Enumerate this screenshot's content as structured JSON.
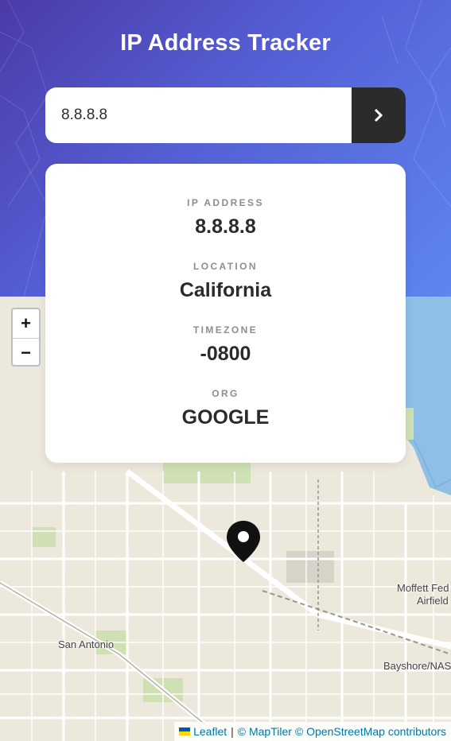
{
  "header": {
    "title": "IP Address Tracker"
  },
  "search": {
    "value": "8.8.8.8",
    "button_icon": "chevron-right-icon"
  },
  "info": {
    "ip_label": "IP ADDRESS",
    "ip_value": "8.8.8.8",
    "location_label": "LOCATION",
    "location_value": "California",
    "timezone_label": "TIMEZONE",
    "timezone_value": "-0800",
    "org_label": "ORG",
    "org_value": "GOOGLE"
  },
  "map": {
    "zoom_in": "+",
    "zoom_out": "−",
    "labels": {
      "san_antonio": "San Antonio",
      "moffett_1": "Moffett Fed",
      "moffett_2": "Airfield",
      "bayshore": "Bayshore/NAS"
    },
    "attribution": {
      "leaflet": "Leaflet",
      "sep": "|",
      "maptiler": "© MapTiler",
      "osm": "© OpenStreetMap contributors"
    },
    "marker_icon": "location-pin-icon"
  },
  "colors": {
    "gradient_start": "#4b3aa8",
    "gradient_end": "#5d86ee",
    "dark": "#2b2b2b",
    "water": "#8fbfe6",
    "land": "#ece8dc",
    "park": "#cfe0b4"
  }
}
